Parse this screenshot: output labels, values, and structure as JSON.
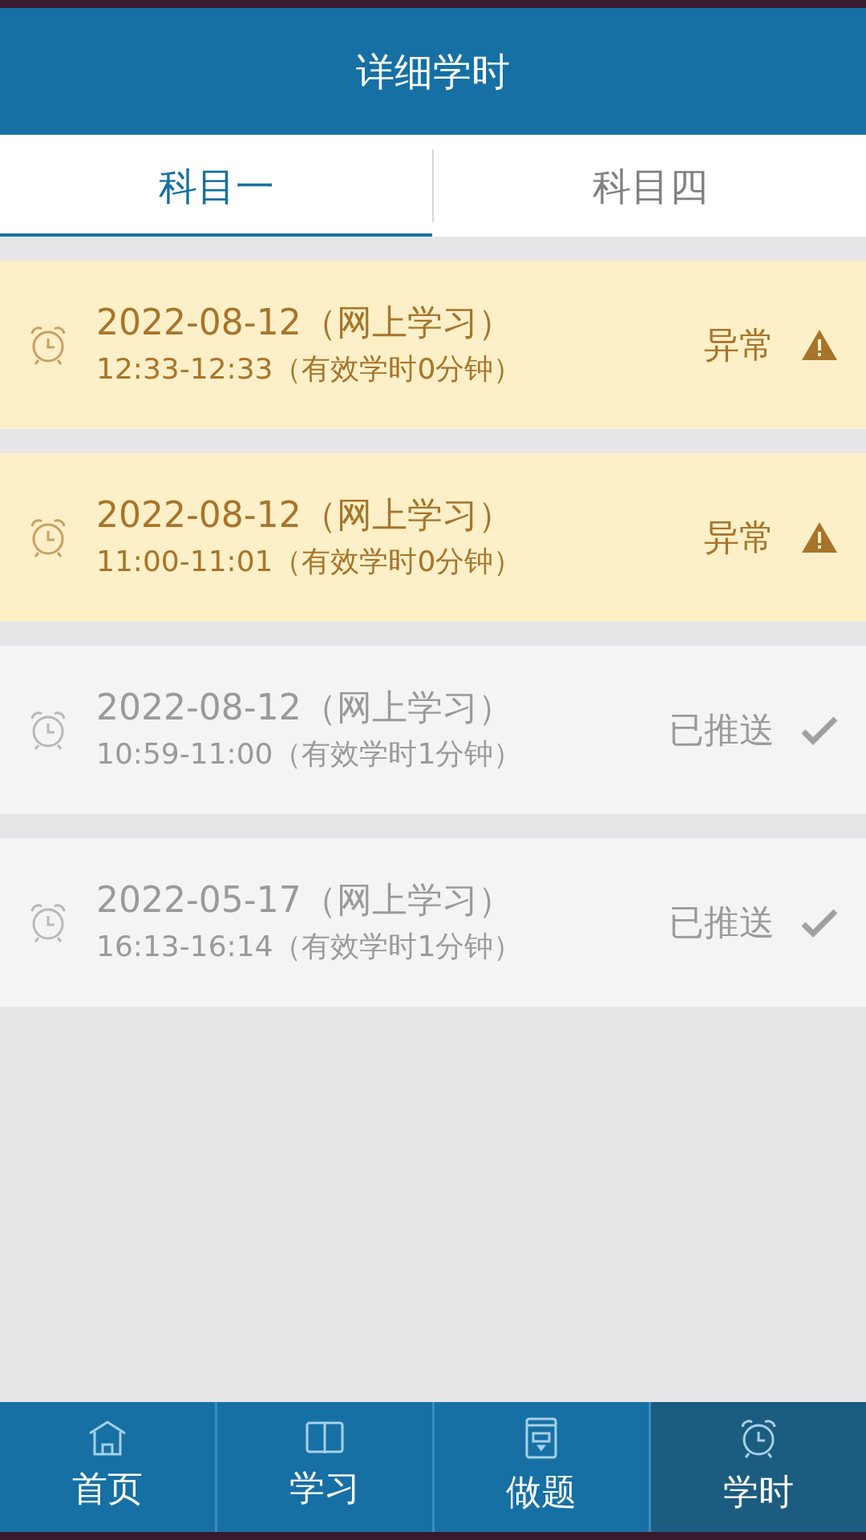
{
  "header": {
    "title": "详细学时"
  },
  "tabs": [
    {
      "label": "科目一",
      "selected": true
    },
    {
      "label": "科目四",
      "selected": false
    }
  ],
  "records": [
    {
      "kind": "abnormal",
      "date": "2022-08-12（网上学习）",
      "time": "12:33-12:33（有效学时0分钟）",
      "status": "异常"
    },
    {
      "kind": "abnormal",
      "date": "2022-08-12（网上学习）",
      "time": "11:00-11:01（有效学时0分钟）",
      "status": "异常"
    },
    {
      "kind": "pushed",
      "date": "2022-08-12（网上学习）",
      "time": "10:59-11:00（有效学时1分钟）",
      "status": "已推送"
    },
    {
      "kind": "pushed",
      "date": "2022-05-17（网上学习）",
      "time": "16:13-16:14（有效学时1分钟）",
      "status": "已推送"
    }
  ],
  "bottom_nav": [
    {
      "kind": "home",
      "label": "首页",
      "selected": false
    },
    {
      "kind": "book",
      "label": "学习",
      "selected": false
    },
    {
      "kind": "exam",
      "label": "做题",
      "selected": false
    },
    {
      "kind": "clock",
      "label": "学时",
      "selected": true
    }
  ]
}
